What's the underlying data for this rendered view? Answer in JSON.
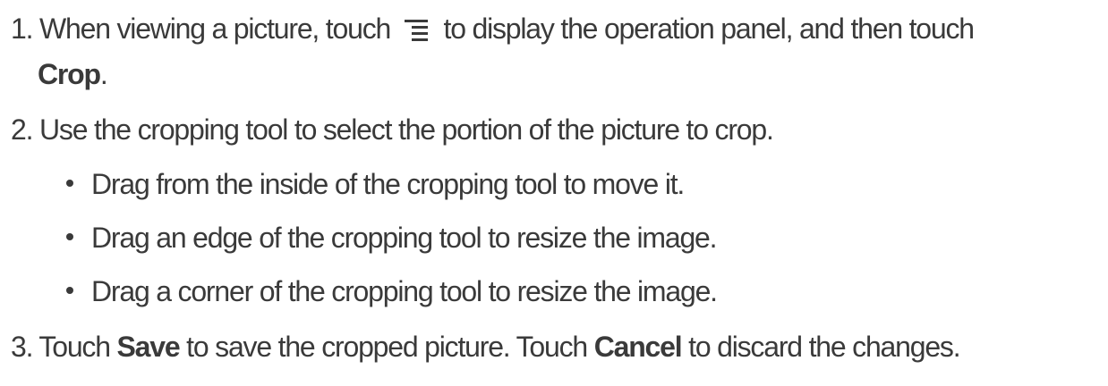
{
  "steps": [
    {
      "number": "1.",
      "text_before_icon": "When viewing a picture, touch",
      "icon": "menu-icon",
      "text_after_icon": "to display the operation panel, and then touch",
      "bold_term": "Crop",
      "text_end": "."
    },
    {
      "number": "2.",
      "text": "Use the cropping tool to select the portion of the picture to crop.",
      "bullets": [
        "Drag from the inside of the cropping tool to move it.",
        "Drag an edge of the cropping tool to resize the image.",
        "Drag a corner of the cropping tool to resize the image."
      ]
    },
    {
      "number": "3.",
      "text_a": "Touch",
      "bold_a": "Save",
      "text_b": "to save the cropped picture. Touch",
      "bold_b": "Cancel",
      "text_c": "to discard the changes."
    }
  ],
  "text_color": "#3a3a3a"
}
